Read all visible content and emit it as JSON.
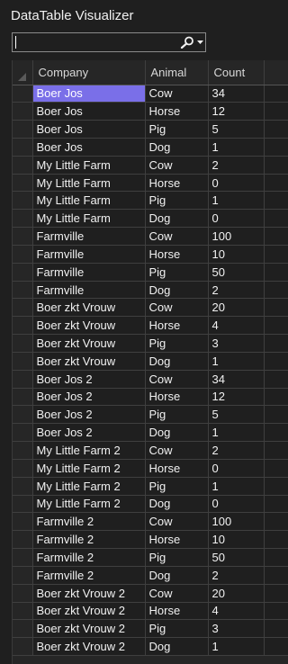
{
  "window": {
    "title": "DataTable Visualizer"
  },
  "search": {
    "value": "",
    "icon": "search-icon",
    "dropdown_icon": "chevron-down-icon"
  },
  "table": {
    "columns": [
      "Company",
      "Animal",
      "Count"
    ],
    "selected_cell": {
      "row": 0,
      "column": "Company"
    },
    "colors": {
      "selection": "#7a6fe8",
      "background": "#1f1f1f",
      "grid_line": "#3f3f3f"
    },
    "rows": [
      [
        "Boer Jos",
        "Cow",
        "34"
      ],
      [
        "Boer Jos",
        "Horse",
        "12"
      ],
      [
        "Boer Jos",
        "Pig",
        "5"
      ],
      [
        "Boer Jos",
        "Dog",
        "1"
      ],
      [
        "My Little Farm",
        "Cow",
        "2"
      ],
      [
        "My Little Farm",
        "Horse",
        "0"
      ],
      [
        "My Little Farm",
        "Pig",
        "1"
      ],
      [
        "My Little Farm",
        "Dog",
        "0"
      ],
      [
        "Farmville",
        "Cow",
        "100"
      ],
      [
        "Farmville",
        "Horse",
        "10"
      ],
      [
        "Farmville",
        "Pig",
        "50"
      ],
      [
        "Farmville",
        "Dog",
        "2"
      ],
      [
        "Boer zkt Vrouw",
        "Cow",
        "20"
      ],
      [
        "Boer zkt Vrouw",
        "Horse",
        "4"
      ],
      [
        "Boer zkt Vrouw",
        "Pig",
        "3"
      ],
      [
        "Boer zkt Vrouw",
        "Dog",
        "1"
      ],
      [
        "Boer Jos 2",
        "Cow",
        "34"
      ],
      [
        "Boer Jos 2",
        "Horse",
        "12"
      ],
      [
        "Boer Jos 2",
        "Pig",
        "5"
      ],
      [
        "Boer Jos 2",
        "Dog",
        "1"
      ],
      [
        "My Little Farm 2",
        "Cow",
        "2"
      ],
      [
        "My Little Farm 2",
        "Horse",
        "0"
      ],
      [
        "My Little Farm 2",
        "Pig",
        "1"
      ],
      [
        "My Little Farm 2",
        "Dog",
        "0"
      ],
      [
        "Farmville 2",
        "Cow",
        "100"
      ],
      [
        "Farmville 2",
        "Horse",
        "10"
      ],
      [
        "Farmville 2",
        "Pig",
        "50"
      ],
      [
        "Farmville 2",
        "Dog",
        "2"
      ],
      [
        "Boer zkt Vrouw 2",
        "Cow",
        "20"
      ],
      [
        "Boer zkt Vrouw 2",
        "Horse",
        "4"
      ],
      [
        "Boer zkt Vrouw 2",
        "Pig",
        "3"
      ],
      [
        "Boer zkt Vrouw 2",
        "Dog",
        "1"
      ]
    ]
  }
}
